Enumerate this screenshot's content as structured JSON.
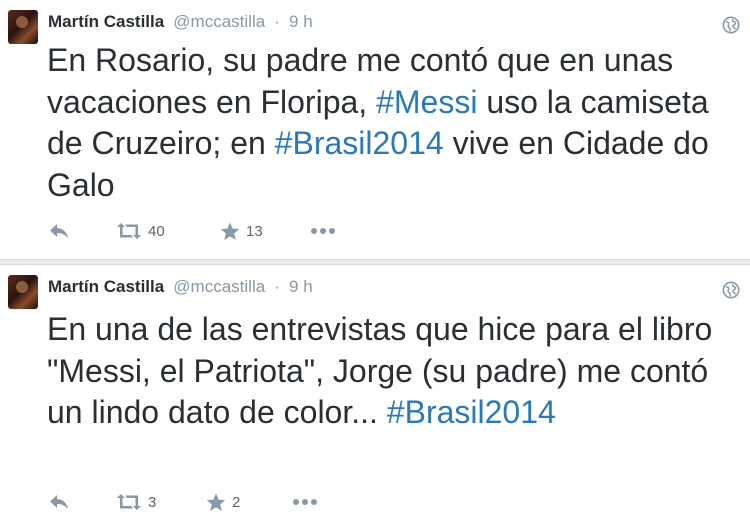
{
  "tweets": [
    {
      "author_name": "Martín Castilla",
      "handle": "@mccastilla",
      "separator": "·",
      "time": "9 h",
      "text_parts": [
        {
          "text": "En Rosario, su padre me contó que en unas vacaciones en Floripa, ",
          "hashtag": false
        },
        {
          "text": "#Messi",
          "hashtag": true
        },
        {
          "text": " uso la camiseta de Cruzeiro; en ",
          "hashtag": false
        },
        {
          "text": "#Brasil2014",
          "hashtag": true
        },
        {
          "text": " vive en Cidade do Galo",
          "hashtag": false
        }
      ],
      "retweet_count": "40",
      "favorite_count": "13"
    },
    {
      "author_name": "Martín Castilla",
      "handle": "@mccastilla",
      "separator": "·",
      "time": "9 h",
      "text_parts": [
        {
          "text": "En una de las entrevistas que hice para el libro \"Messi, el Patriota\", Jorge (su padre) me contó un lindo dato de color... ",
          "hashtag": false
        },
        {
          "text": "#Brasil2014",
          "hashtag": true
        }
      ],
      "retweet_count": "3",
      "favorite_count": "2"
    }
  ],
  "icons": {
    "reply": "reply-icon",
    "retweet": "retweet-icon",
    "favorite": "star-icon",
    "more": "more-icon",
    "visibility": "globe-icon"
  },
  "colors": {
    "text": "#292f33",
    "meta": "#8899a6",
    "hashtag": "#2a7ab8",
    "background": "#e9ebed"
  }
}
